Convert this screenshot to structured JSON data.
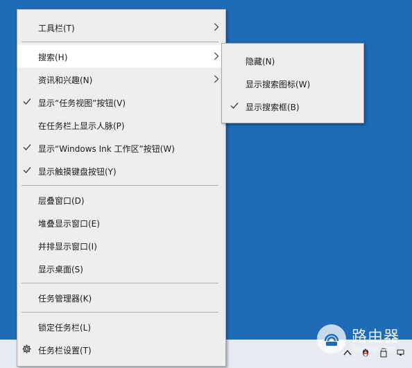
{
  "main_menu": {
    "items": [
      {
        "label": "工具栏(T)"
      },
      {
        "label": "搜索(H)"
      },
      {
        "label": "资讯和兴趣(N)"
      },
      {
        "label": "显示“任务视图”按钮(V)"
      },
      {
        "label": "在任务栏上显示人脉(P)"
      },
      {
        "label": "显示“Windows Ink 工作区”按钮(W)"
      },
      {
        "label": "显示触摸键盘按钮(Y)"
      },
      {
        "label": "层叠窗口(D)"
      },
      {
        "label": "堆叠显示窗口(E)"
      },
      {
        "label": "并排显示窗口(I)"
      },
      {
        "label": "显示桌面(S)"
      },
      {
        "label": "任务管理器(K)"
      },
      {
        "label": "锁定任务栏(L)"
      },
      {
        "label": "任务栏设置(T)"
      }
    ]
  },
  "sub_menu": {
    "items": [
      {
        "label": "隐藏(N)"
      },
      {
        "label": "显示搜索图标(W)"
      },
      {
        "label": "显示搜索框(B)"
      }
    ]
  },
  "watermark": {
    "title": "路由器",
    "subtitle": "luyouqi.com"
  },
  "colors": {
    "desktop": "#1e6bb8",
    "menu_bg": "#eeeeee",
    "highlight": "#ffffff",
    "taskbar": "#e7ecf3"
  }
}
